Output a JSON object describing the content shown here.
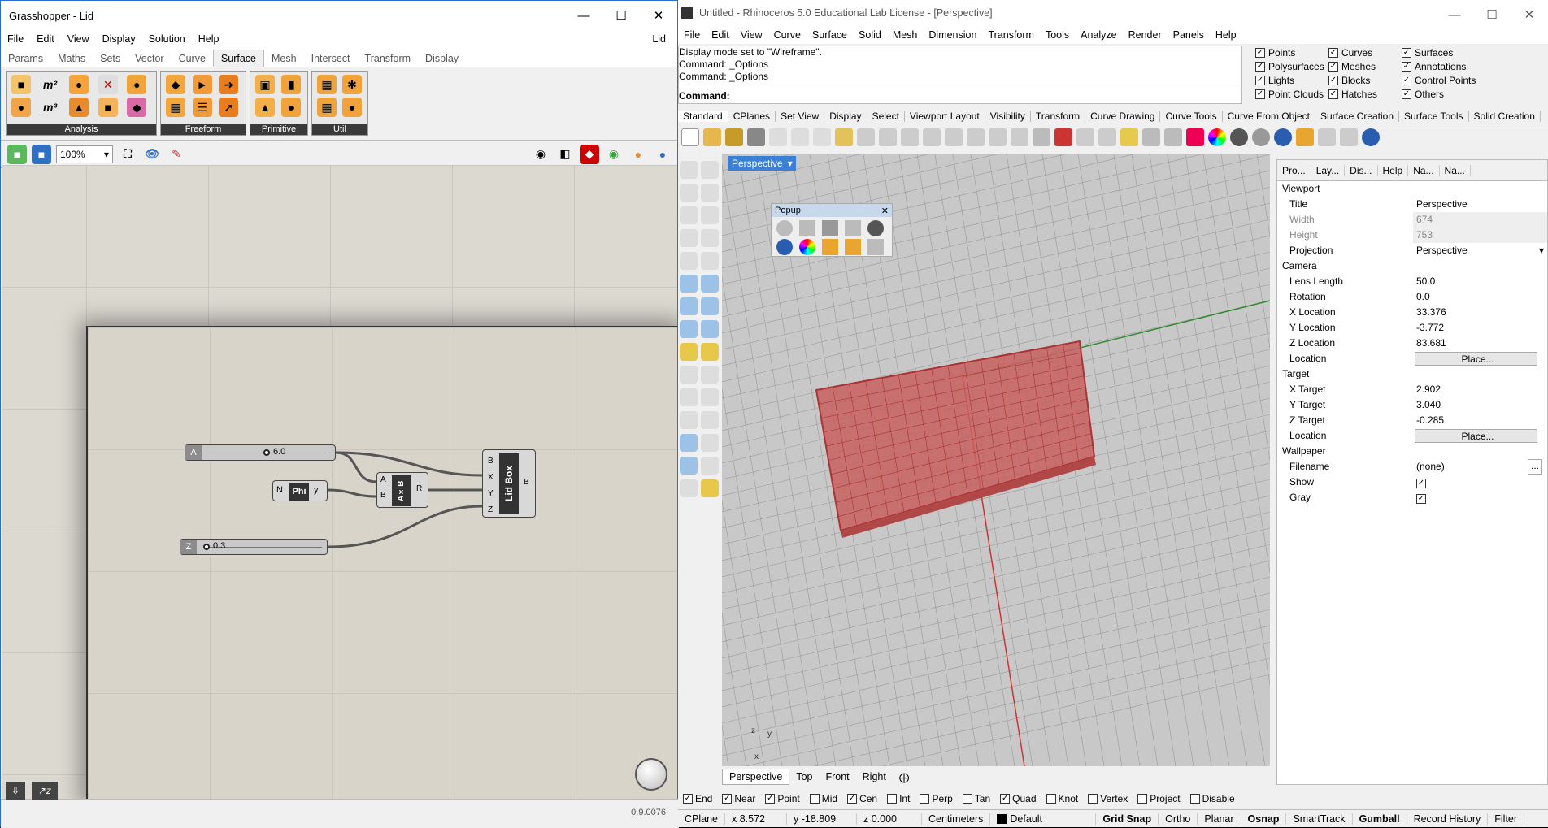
{
  "gh": {
    "title": "Grasshopper - Lid",
    "doc_label": "Lid",
    "menu": [
      "File",
      "Edit",
      "View",
      "Display",
      "Solution",
      "Help"
    ],
    "tabs": [
      "Params",
      "Maths",
      "Sets",
      "Vector",
      "Curve",
      "Surface",
      "Mesh",
      "Intersect",
      "Transform",
      "Display"
    ],
    "active_tab": "Surface",
    "groups": [
      "Analysis",
      "Freeform",
      "Primitive",
      "Util"
    ],
    "zoom": "100%",
    "slider_a": {
      "label": "A",
      "value": "6.0"
    },
    "slider_z": {
      "label": "Z",
      "value": "0.3"
    },
    "phi": {
      "in": "N",
      "name": "Phi",
      "out": "y"
    },
    "mult": {
      "in_a": "A",
      "in_b": "B",
      "name": "A×B",
      "out": "R"
    },
    "lidbox": {
      "inputs": [
        "B",
        "X",
        "Y",
        "Z"
      ],
      "name": "Lid Box",
      "out": "B"
    },
    "version": "0.9.0076"
  },
  "rh": {
    "title": "Untitled - Rhinoceros 5.0 Educational Lab License - [Perspective]",
    "menu": [
      "File",
      "Edit",
      "View",
      "Curve",
      "Surface",
      "Solid",
      "Mesh",
      "Dimension",
      "Transform",
      "Tools",
      "Analyze",
      "Render",
      "Panels",
      "Help"
    ],
    "history": [
      "Display mode set to \"Wireframe\".",
      "Command: _Options",
      "Command: _Options"
    ],
    "command_label": "Command:",
    "filters": [
      {
        "label": "Points",
        "checked": true
      },
      {
        "label": "Curves",
        "checked": true
      },
      {
        "label": "Surfaces",
        "checked": true
      },
      {
        "label": "Polysurfaces",
        "checked": true
      },
      {
        "label": "Meshes",
        "checked": true
      },
      {
        "label": "Annotations",
        "checked": true
      },
      {
        "label": "Lights",
        "checked": true
      },
      {
        "label": "Blocks",
        "checked": true
      },
      {
        "label": "Control Points",
        "checked": true
      },
      {
        "label": "Point Clouds",
        "checked": true
      },
      {
        "label": "Hatches",
        "checked": true
      },
      {
        "label": "Others",
        "checked": true
      }
    ],
    "toolbar_tabs": [
      "Standard",
      "CPlanes",
      "Set View",
      "Display",
      "Select",
      "Viewport Layout",
      "Visibility",
      "Transform",
      "Curve Drawing",
      "Curve Tools",
      "Curve From Object",
      "Surface Creation",
      "Surface Tools",
      "Solid Creation"
    ],
    "viewport_label": "Perspective",
    "popup_title": "Popup",
    "view_tabs": [
      "Perspective",
      "Top",
      "Front",
      "Right"
    ],
    "snaps": [
      {
        "label": "End",
        "checked": true
      },
      {
        "label": "Near",
        "checked": true
      },
      {
        "label": "Point",
        "checked": true
      },
      {
        "label": "Mid",
        "checked": false
      },
      {
        "label": "Cen",
        "checked": true
      },
      {
        "label": "Int",
        "checked": false
      },
      {
        "label": "Perp",
        "checked": false
      },
      {
        "label": "Tan",
        "checked": false
      },
      {
        "label": "Quad",
        "checked": true
      },
      {
        "label": "Knot",
        "checked": false
      },
      {
        "label": "Vertex",
        "checked": false
      },
      {
        "label": "Project",
        "checked": false
      },
      {
        "label": "Disable",
        "checked": false
      }
    ],
    "status": {
      "cplane": "CPlane",
      "x": "x 8.572",
      "y": "y -18.809",
      "z": "z 0.000",
      "units": "Centimeters",
      "layer": "Default",
      "toggles": [
        "Grid Snap",
        "Ortho",
        "Planar",
        "Osnap",
        "SmartTrack",
        "Gumball",
        "Record History",
        "Filter"
      ]
    },
    "props": {
      "tabs": [
        "Pro...",
        "Lay...",
        "Dis...",
        "Help",
        "Na...",
        "Na..."
      ],
      "viewport_hdr": "Viewport",
      "title_k": "Title",
      "title_v": "Perspective",
      "width_k": "Width",
      "width_v": "674",
      "height_k": "Height",
      "height_v": "753",
      "proj_k": "Projection",
      "proj_v": "Perspective",
      "camera_hdr": "Camera",
      "lens_k": "Lens Length",
      "lens_v": "50.0",
      "rot_k": "Rotation",
      "rot_v": "0.0",
      "xl_k": "X Location",
      "xl_v": "33.376",
      "yl_k": "Y Location",
      "yl_v": "-3.772",
      "zl_k": "Z Location",
      "zl_v": "83.681",
      "loc_k": "Location",
      "place": "Place...",
      "target_hdr": "Target",
      "xt_k": "X Target",
      "xt_v": "2.902",
      "yt_k": "Y Target",
      "yt_v": "3.040",
      "zt_k": "Z Target",
      "zt_v": "-0.285",
      "wall_hdr": "Wallpaper",
      "file_k": "Filename",
      "file_v": "(none)",
      "show_k": "Show",
      "gray_k": "Gray"
    }
  }
}
